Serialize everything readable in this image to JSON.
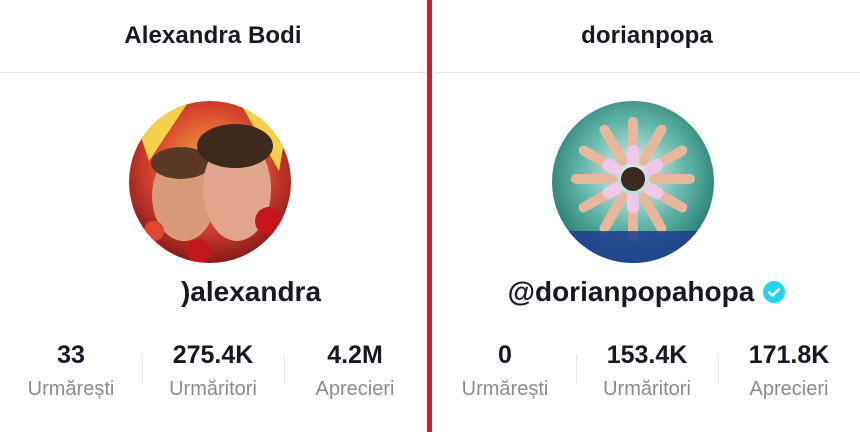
{
  "profiles": [
    {
      "title": "Alexandra Bodi",
      "username": ")alexandra",
      "verified": false,
      "stats": [
        {
          "value": "33",
          "label": "Urmărești"
        },
        {
          "value": "275.4K",
          "label": "Urmăritori"
        },
        {
          "value": "4.2M",
          "label": "Aprecieri"
        }
      ]
    },
    {
      "title": "dorianpopa",
      "username": "@dorianpopahopa",
      "verified": true,
      "stats": [
        {
          "value": "0",
          "label": "Urmărești"
        },
        {
          "value": "153.4K",
          "label": "Urmăritori"
        },
        {
          "value": "171.8K",
          "label": "Aprecieri"
        }
      ]
    }
  ],
  "colors": {
    "divider": "#d01f26",
    "verified": "#20d5ec",
    "muted_text": "#8a8b91"
  },
  "icons": [
    "verified-badge-icon"
  ]
}
